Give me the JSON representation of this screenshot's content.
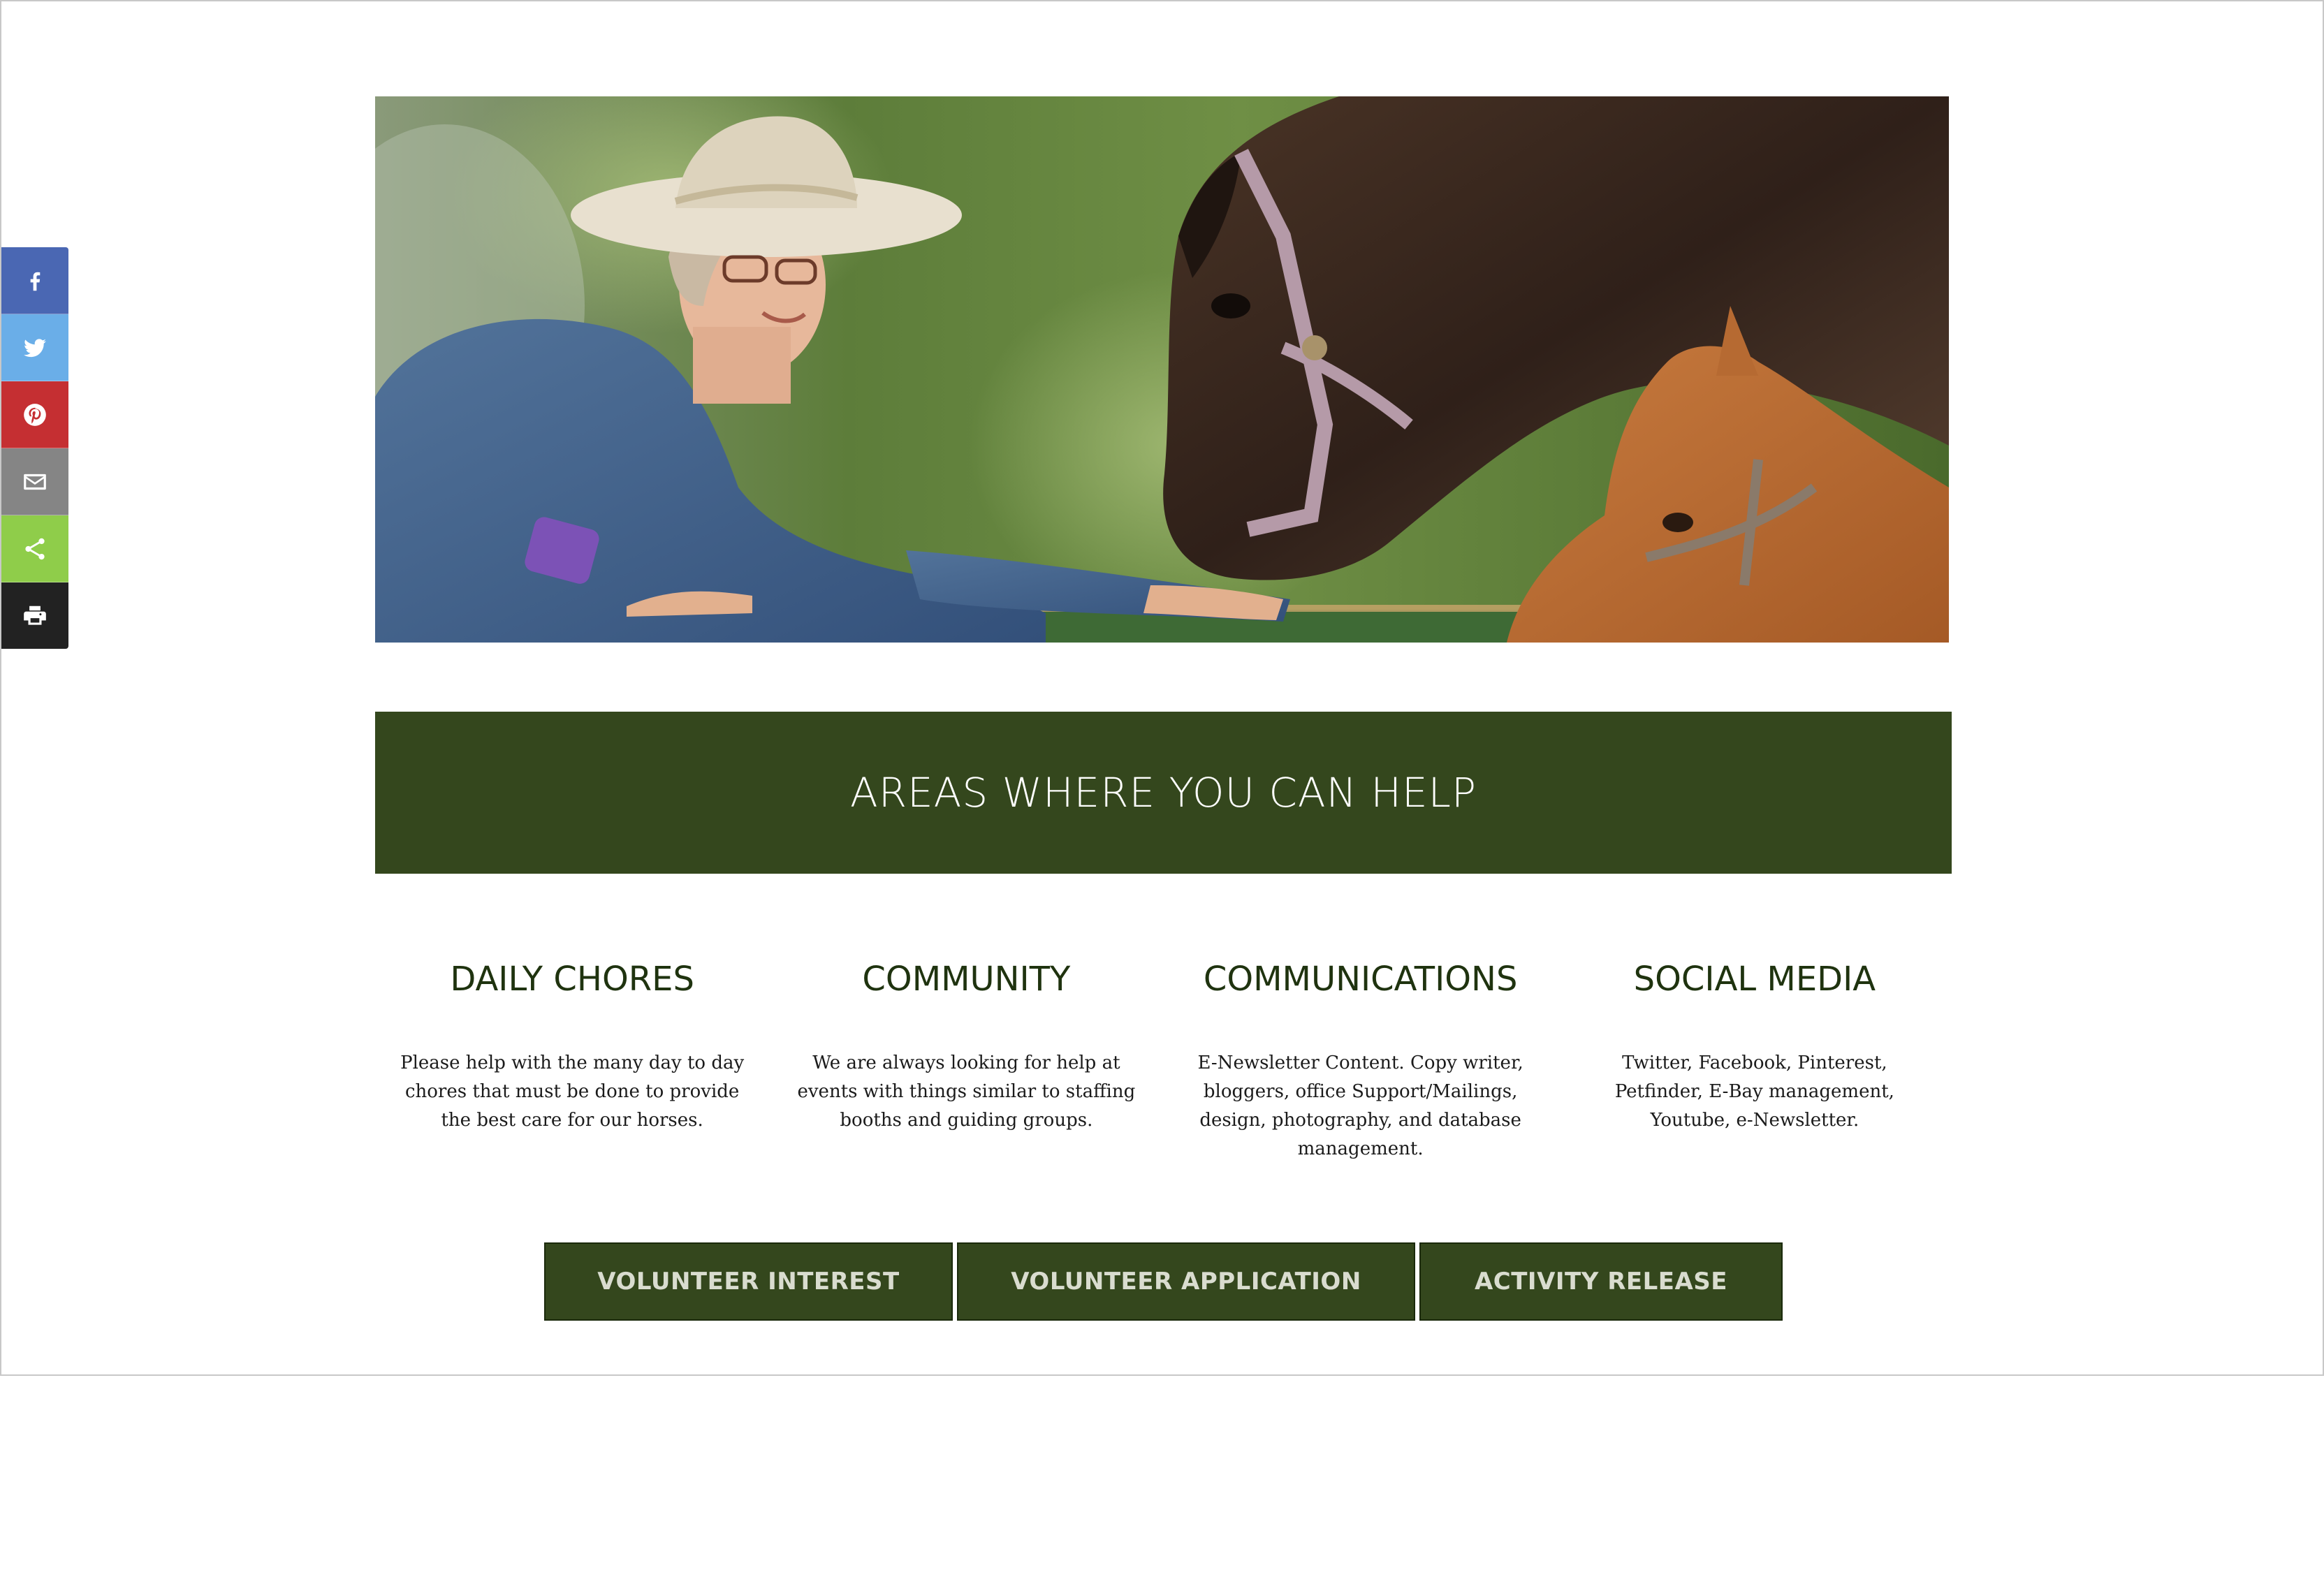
{
  "share_bar": {
    "buttons": [
      {
        "name": "facebook",
        "icon": "facebook-icon",
        "color": "#3b5998"
      },
      {
        "name": "twitter",
        "icon": "twitter-icon",
        "color": "#55acee"
      },
      {
        "name": "pinterest",
        "icon": "pinterest-icon",
        "color": "#cb2027"
      },
      {
        "name": "email",
        "icon": "email-icon",
        "color": "#7d7d7d"
      },
      {
        "name": "share",
        "icon": "share-icon",
        "color": "#95d03a"
      },
      {
        "name": "print",
        "icon": "print-icon",
        "color": "#222222"
      }
    ]
  },
  "hero": {
    "subject": "woman-with-horses-photo"
  },
  "areas": {
    "title": "AREAS WHERE YOU CAN HELP",
    "band_color": "#34471d",
    "items": [
      {
        "title": "DAILY CHORES",
        "text": "Please help with the many day to day chores that must be done to provide the best care for our horses."
      },
      {
        "title": "COMMUNITY",
        "text": "We are always looking for help at events with things similar to staffing booths and guiding groups."
      },
      {
        "title": "COMMUNICATIONS",
        "text": "E-Newsletter Content. Copy writer, bloggers, office Support/Mailings, design, photography, and database management."
      },
      {
        "title": "SOCIAL MEDIA",
        "text": "Twitter, Facebook, Pinterest, Petfinder, E-Bay management, Youtube, e-Newsletter."
      }
    ]
  },
  "actions": {
    "interest": "VOLUNTEER INTEREST",
    "application": "VOLUNTEER APPLICATION",
    "release": "ACTIVITY RELEASE"
  }
}
